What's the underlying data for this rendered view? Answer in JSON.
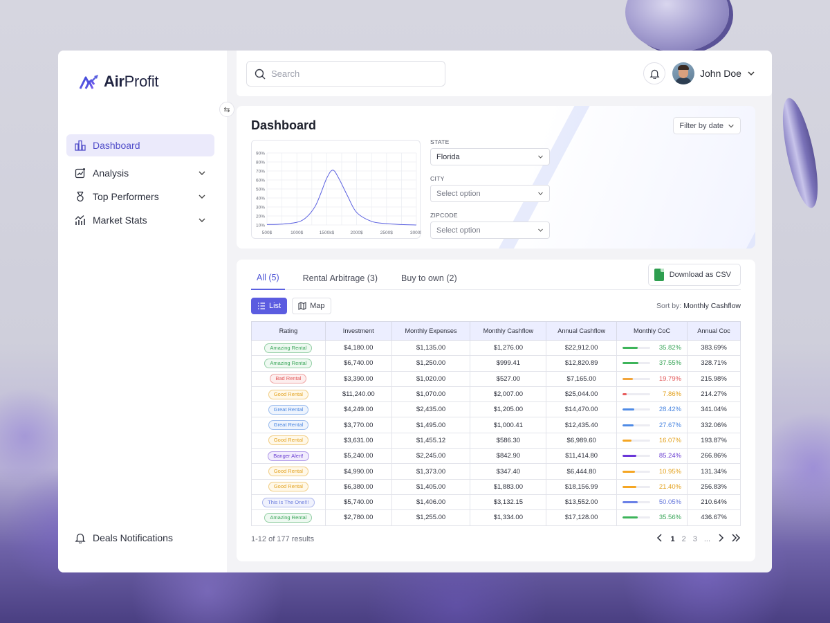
{
  "brand": {
    "name_part1": "Air",
    "name_part2": "Profit"
  },
  "sidebar": {
    "items": [
      {
        "label": "Dashboard",
        "icon": "bar-chart-icon",
        "active": true
      },
      {
        "label": "Analysis",
        "icon": "analysis-icon",
        "expandable": true
      },
      {
        "label": "Top Performers",
        "icon": "medal-icon",
        "expandable": true
      },
      {
        "label": "Market Stats",
        "icon": "market-stats-icon",
        "expandable": true
      }
    ],
    "footer_label": "Deals Notifications"
  },
  "header": {
    "search_placeholder": "Search",
    "user_name": "John Doe"
  },
  "dashboard": {
    "title": "Dashboard",
    "filter_label": "Filter by date",
    "fields": {
      "state_label": "STATE",
      "state_value": "Florida",
      "city_label": "CITY",
      "city_value": "Select option",
      "zip_label": "ZIPCODE",
      "zip_value": "Select option"
    }
  },
  "chart_data": {
    "type": "line",
    "title": "",
    "xlabel": "",
    "ylabel": "",
    "x_ticks": [
      "500$",
      "1000$",
      "1500k$",
      "2000$",
      "2500$",
      "3000$"
    ],
    "y_ticks": [
      "10%",
      "20%",
      "30%",
      "40%",
      "50%",
      "60%",
      "70%",
      "80%",
      "90%"
    ],
    "ylim": [
      10,
      90
    ],
    "xlim": [
      500,
      3000
    ],
    "grid": true,
    "series": [
      {
        "color": "#5a60e0",
        "x": [
          500,
          750,
          1000,
          1150,
          1300,
          1400,
          1500,
          1600,
          1700,
          1850,
          2000,
          2250,
          2500,
          2750,
          3000
        ],
        "y": [
          10.5,
          11,
          13,
          18,
          30,
          45,
          62,
          71,
          62,
          42,
          24,
          14,
          11.5,
          10.5,
          10
        ]
      }
    ]
  },
  "tabs": [
    {
      "label": "All (5)",
      "active": true
    },
    {
      "label": "Rental Arbitrage (3)"
    },
    {
      "label": "Buy to own (2)"
    }
  ],
  "csv_label": "Download as CSV",
  "views": {
    "list": "List",
    "map": "Map"
  },
  "sort": {
    "prefix": "Sort by:",
    "value": "Monthly Cashflow"
  },
  "table": {
    "columns": [
      "Rating",
      "Investment",
      "Monthly Expenses",
      "Monthly Cashflow",
      "Annual Cashflow",
      "Monthly CoC",
      "Annual Coc"
    ],
    "rows": [
      {
        "rating": "Amazing Rental",
        "kind": "amazing",
        "investment": "$4,180.00",
        "expenses": "$1,135.00",
        "cashflow": "$1,276.00",
        "annual": "$22,912.00",
        "coc": "35.82%",
        "coc_frac": 0.55,
        "annual_coc": "383.69%"
      },
      {
        "rating": "Amazing Rental",
        "kind": "amazing",
        "investment": "$6,740.00",
        "expenses": "$1,250.00",
        "cashflow": "$999.41",
        "annual": "$12,820.89",
        "coc": "37.55%",
        "coc_frac": 0.57,
        "annual_coc": "328.71%"
      },
      {
        "rating": "Bad Rental",
        "kind": "bad",
        "investment": "$3,390.00",
        "expenses": "$1,020.00",
        "cashflow": "$527.00",
        "annual": "$7,165.00",
        "coc": "19.79%",
        "coc_frac": 0.38,
        "annual_coc": "215.98%"
      },
      {
        "rating": "Good Rental",
        "kind": "good",
        "investment": "$11,240.00",
        "expenses": "$1,070.00",
        "cashflow": "$2,007.00",
        "annual": "$25,044.00",
        "coc": "7.86%",
        "coc_frac": 0.14,
        "annual_coc": "214.27%"
      },
      {
        "rating": "Great Rental",
        "kind": "great",
        "investment": "$4,249.00",
        "expenses": "$2,435.00",
        "cashflow": "$1,205.00",
        "annual": "$14,470.00",
        "coc": "28.42%",
        "coc_frac": 0.42,
        "annual_coc": "341.04%"
      },
      {
        "rating": "Great Rental",
        "kind": "great",
        "investment": "$3,770.00",
        "expenses": "$1,495.00",
        "cashflow": "$1,000.41",
        "annual": "$12,435.40",
        "coc": "27.67%",
        "coc_frac": 0.41,
        "annual_coc": "332.06%"
      },
      {
        "rating": "Good Rental",
        "kind": "good",
        "investment": "$3,631.00",
        "expenses": "$1,455.12",
        "cashflow": "$586.30",
        "annual": "$6,989.60",
        "coc": "16.07%",
        "coc_frac": 0.32,
        "annual_coc": "193.87%"
      },
      {
        "rating": "Banger Alert!",
        "kind": "banger",
        "investment": "$5,240.00",
        "expenses": "$2,245.00",
        "cashflow": "$842.90",
        "annual": "$11,414.80",
        "coc": "85.24%",
        "coc_frac": 0.5,
        "annual_coc": "266.86%"
      },
      {
        "rating": "Good Rental",
        "kind": "good",
        "investment": "$4,990.00",
        "expenses": "$1,373.00",
        "cashflow": "$347.40",
        "annual": "$6,444.80",
        "coc": "10.95%",
        "coc_frac": 0.45,
        "annual_coc": "131.34%"
      },
      {
        "rating": "Good Rental",
        "kind": "good",
        "investment": "$6,380.00",
        "expenses": "$1,405.00",
        "cashflow": "$1,883.00",
        "annual": "$18,156.99",
        "coc": "21.40%",
        "coc_frac": 0.5,
        "annual_coc": "256.83%"
      },
      {
        "rating": "This Is The One!!!",
        "kind": "one",
        "investment": "$5,740.00",
        "expenses": "$1,406.00",
        "cashflow": "$3,132.15",
        "annual": "$13,552.00",
        "coc": "50.05%",
        "coc_frac": 0.55,
        "annual_coc": "210.64%"
      },
      {
        "rating": "Amazing Rental",
        "kind": "amazing",
        "investment": "$2,780.00",
        "expenses": "$1,255.00",
        "cashflow": "$1,334.00",
        "annual": "$17,128.00",
        "coc": "35.56%",
        "coc_frac": 0.55,
        "annual_coc": "436.67%"
      }
    ]
  },
  "badge_colors": {
    "amazing": {
      "fg": "#3aa559",
      "bg": "#eef9f1",
      "bar": "#3db45a"
    },
    "bad": {
      "fg": "#e2595a",
      "bg": "#fdeeee",
      "bar": "#f2a53a"
    },
    "good": {
      "fg": "#e3a21f",
      "bg": "#fff8e8",
      "bar": "#f5a623"
    },
    "great": {
      "fg": "#4a86e0",
      "bg": "#eef4fd",
      "bar": "#4f8be6"
    },
    "banger": {
      "fg": "#6b3fd1",
      "bg": "#f1ecfd",
      "bar": "#6a36d8"
    },
    "one": {
      "fg": "#6a7bdc",
      "bg": "#f0f2fd",
      "bar": "#6a80e6"
    },
    "bad_bar_override": "#e85b5b"
  },
  "pagination": {
    "summary": "1-12 of 177 results",
    "pages": [
      "1",
      "2",
      "3",
      "..."
    ],
    "current": "1"
  }
}
